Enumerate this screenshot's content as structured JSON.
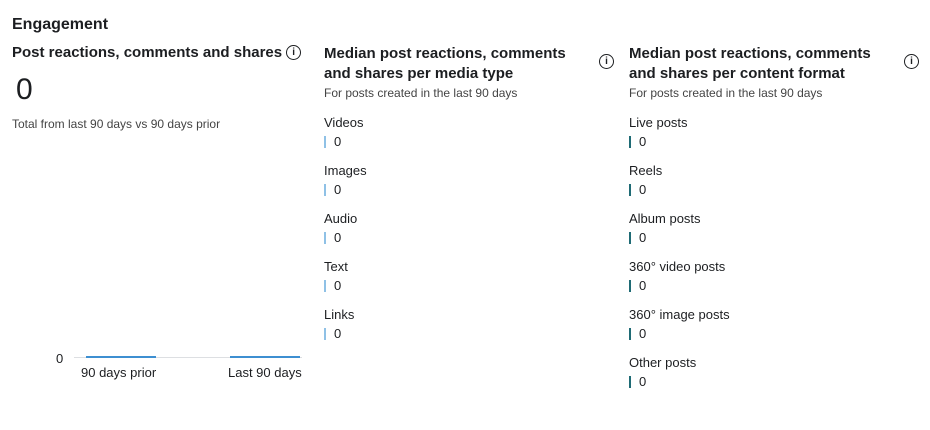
{
  "section": {
    "title": "Engagement"
  },
  "total": {
    "title": "Post reactions, comments and shares",
    "value": "0",
    "subtitle": "Total from last 90 days vs 90 days prior"
  },
  "chart_data": {
    "type": "bar",
    "categories": [
      "90 days prior",
      "Last 90 days"
    ],
    "values": [
      0,
      0
    ],
    "y_tick": "0",
    "bar_color": "#3d8fd1"
  },
  "media_type": {
    "title": "Median post reactions, comments and shares per media type",
    "subtitle": "For posts created in the last 90 days",
    "items": [
      {
        "label": "Videos",
        "value": "0"
      },
      {
        "label": "Images",
        "value": "0"
      },
      {
        "label": "Audio",
        "value": "0"
      },
      {
        "label": "Text",
        "value": "0"
      },
      {
        "label": "Links",
        "value": "0"
      }
    ],
    "tick_color": "#8fc1e6"
  },
  "content_format": {
    "title": "Median post reactions, comments and shares per content format",
    "subtitle": "For posts created in the last 90 days",
    "items": [
      {
        "label": "Live posts",
        "value": "0"
      },
      {
        "label": "Reels",
        "value": "0"
      },
      {
        "label": "Album posts",
        "value": "0"
      },
      {
        "label": "360° video posts",
        "value": "0"
      },
      {
        "label": "360° image posts",
        "value": "0"
      },
      {
        "label": "Other posts",
        "value": "0"
      }
    ],
    "tick_color": "#1f6b75"
  },
  "icons": {
    "info": "info-icon"
  }
}
